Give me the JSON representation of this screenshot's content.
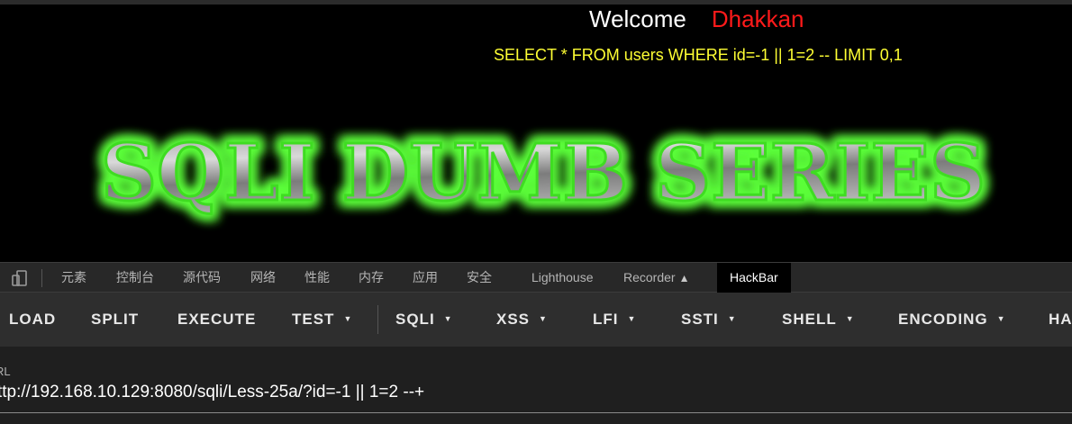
{
  "page": {
    "welcome": "Welcome",
    "name": "Dhakkan",
    "query": "SELECT * FROM users WHERE id=-1 || 1=2 -- LIMIT 0,1",
    "banner_text": "SQLI DUMB SERIES",
    "colors": {
      "name": "#ff1a1a",
      "query": "#ffff33",
      "banner_glow": "#5cff3a"
    }
  },
  "devtools": {
    "toolbar_icons": [
      "inspect-element-icon",
      "device-toolbar-icon"
    ],
    "tabs": [
      "元素",
      "控制台",
      "源代码",
      "网络",
      "性能",
      "内存",
      "应用",
      "安全",
      "Lighthouse",
      "Recorder",
      "HackBar"
    ],
    "active_tab": "HackBar"
  },
  "hackbar": {
    "buttons": [
      "LOAD",
      "SPLIT",
      "EXECUTE",
      "TEST",
      "SQLI",
      "XSS",
      "LFI",
      "SSTI",
      "SHELL",
      "ENCODING",
      "HA"
    ],
    "url_label": "RL",
    "url_value": "ttp://192.168.10.129:8080/sqli/Less-25a/?id=-1 || 1=2 --+"
  }
}
